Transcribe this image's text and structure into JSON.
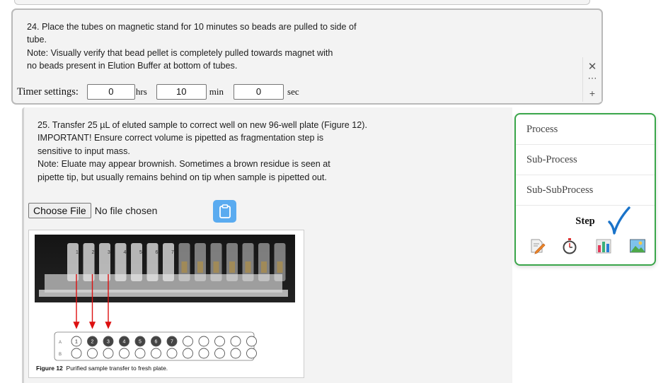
{
  "step24": {
    "text": "24. Place the tubes on magnetic stand for 10 minutes so beads are pulled to side of\ntube.\nNote: Visually verify that bead pellet is completely pulled towards magnet with\nno beads present in Elution Buffer at bottom of tubes.",
    "timer": {
      "label": "Timer settings:",
      "hrs_value": "0",
      "hrs_unit": "hrs",
      "min_value": "10",
      "min_unit": "min",
      "sec_value": "0",
      "sec_unit": "sec"
    },
    "actions": {
      "close": "✕",
      "more": "⋯",
      "add": "+"
    }
  },
  "step25": {
    "text": "25. Transfer 25 µL of eluted sample to correct well on new 96-well plate (Figure 12).\nIMPORTANT! Ensure correct volume is pipetted as fragmentation step is\nsensitive to input mass.\nNote: Eluate may appear brownish. Sometimes a brown residue is seen at\npipette tip, but usually remains behind on tip when sample is pipetted out.",
    "file_button": "Choose File",
    "file_status": "No file chosen",
    "figure": {
      "tube_numbers": [
        "1",
        "2",
        "3",
        "4",
        "5",
        "6",
        "7"
      ],
      "row_labels": [
        "A",
        "B"
      ],
      "caption_label": "Figure 12",
      "caption_text": "Purified sample transfer to fresh plate."
    }
  },
  "popup": {
    "items": [
      "Process",
      "Sub-Process",
      "Sub-SubProcess"
    ],
    "step_label": "Step",
    "icons": [
      "edit-note-icon",
      "stopwatch-icon",
      "bar-chart-icon",
      "image-icon"
    ],
    "border_color": "#3aa64a",
    "check_color": "#1a73c9"
  }
}
